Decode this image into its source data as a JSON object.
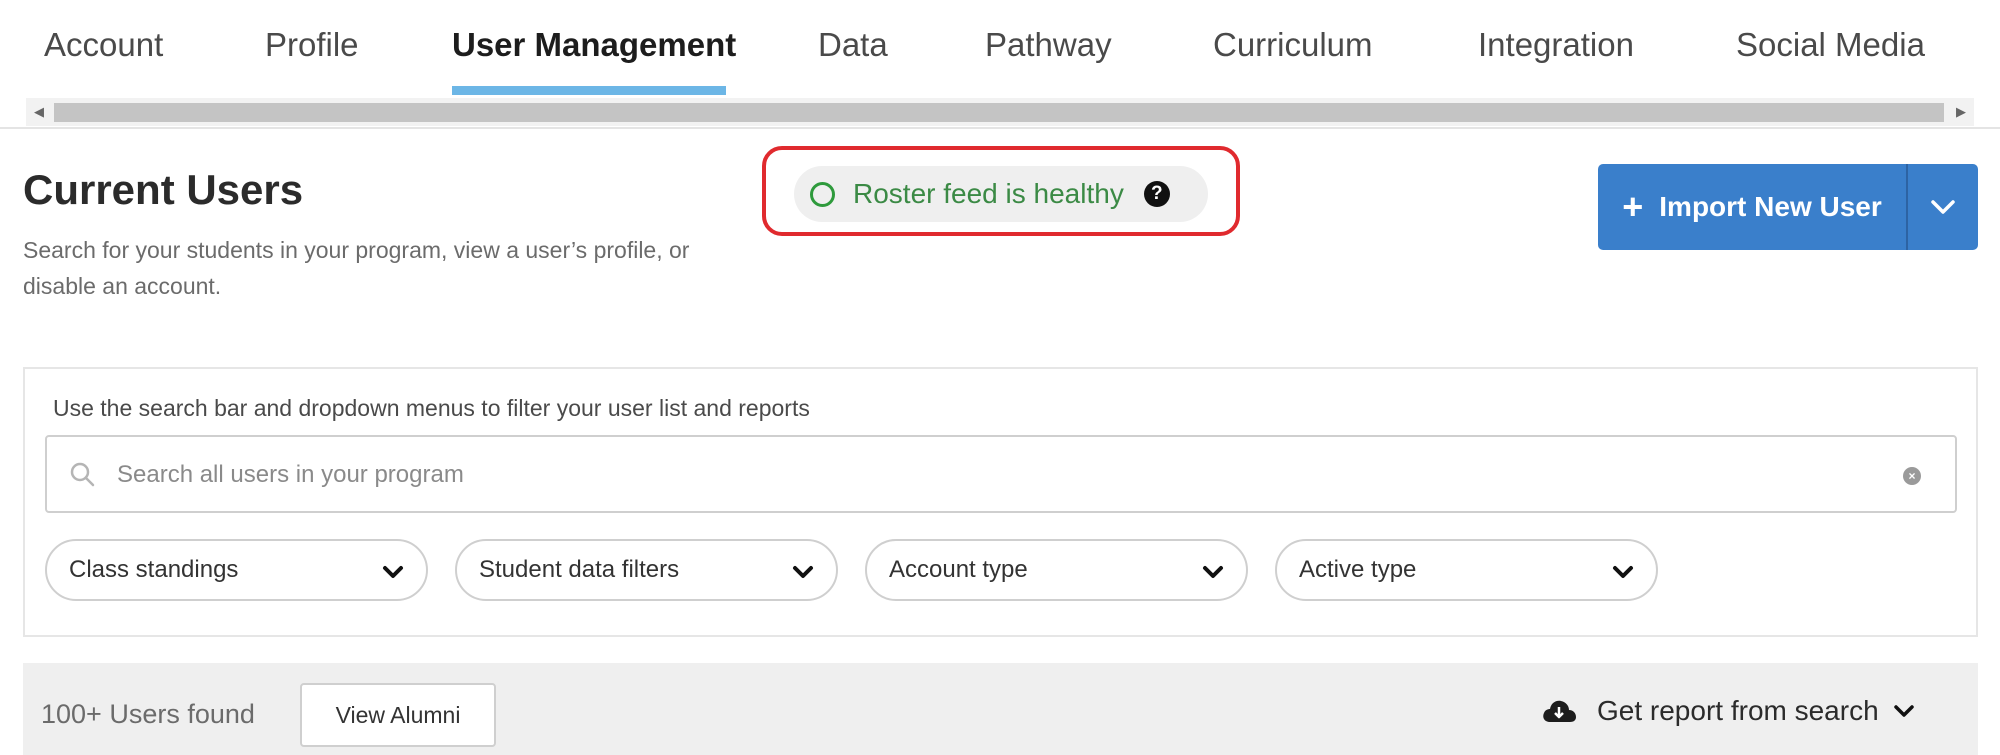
{
  "tabs": [
    {
      "label": "Account",
      "active": false
    },
    {
      "label": "Profile",
      "active": false
    },
    {
      "label": "User Management",
      "active": true
    },
    {
      "label": "Data",
      "active": false
    },
    {
      "label": "Pathway",
      "active": false
    },
    {
      "label": "Curriculum",
      "active": false
    },
    {
      "label": "Integration",
      "active": false
    },
    {
      "label": "Social Media",
      "active": false
    }
  ],
  "header": {
    "title": "Current Users",
    "description": "Search for your students in your program, view a user’s profile, or disable an account."
  },
  "roster_status": {
    "text": "Roster feed is healthy",
    "color": "#2e9a3c",
    "icon": "help-icon"
  },
  "import_button": {
    "label": "Import New User",
    "color": "#3a7fcb"
  },
  "filters": {
    "hint": "Use the search bar and dropdown menus to filter your user list and reports",
    "search_placeholder": "Search all users in your program",
    "dropdowns": [
      "Class standings",
      "Student data filters",
      "Account type",
      "Active type"
    ]
  },
  "results": {
    "count_text": "100+ Users found",
    "alumni_button": "View Alumni",
    "report_link": "Get report from search"
  },
  "colors": {
    "accent": "#6cb6e6",
    "highlight_outline": "#e02a2e"
  }
}
